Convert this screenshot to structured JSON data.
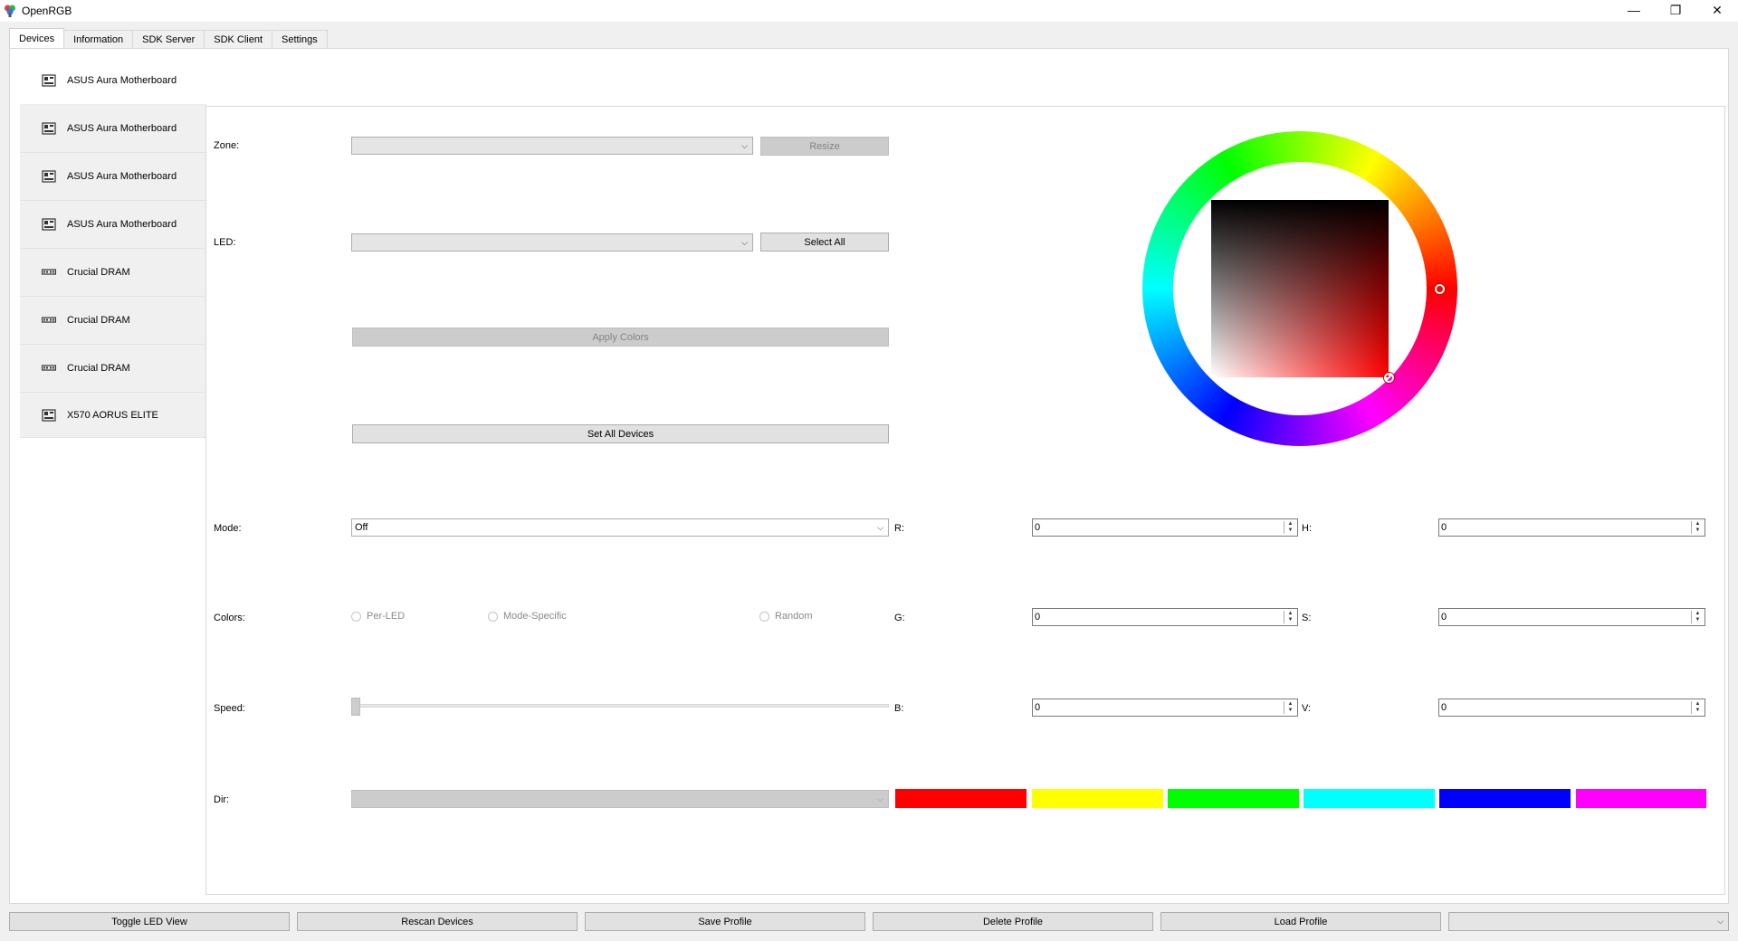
{
  "window": {
    "title": "OpenRGB",
    "minimize_label": "—",
    "restore_label": "❐",
    "close_label": "✕"
  },
  "tabs": [
    {
      "label": "Devices"
    },
    {
      "label": "Information"
    },
    {
      "label": "SDK Server"
    },
    {
      "label": "SDK Client"
    },
    {
      "label": "Settings"
    }
  ],
  "devices": [
    {
      "label": "ASUS Aura Motherboard",
      "icon": "motherboard-icon"
    },
    {
      "label": "ASUS Aura Motherboard",
      "icon": "motherboard-icon"
    },
    {
      "label": "ASUS Aura Motherboard",
      "icon": "motherboard-icon"
    },
    {
      "label": "ASUS Aura Motherboard",
      "icon": "motherboard-icon"
    },
    {
      "label": "Crucial DRAM",
      "icon": "dram-icon"
    },
    {
      "label": "Crucial DRAM",
      "icon": "dram-icon"
    },
    {
      "label": "Crucial DRAM",
      "icon": "dram-icon"
    },
    {
      "label": "X570 AORUS ELITE",
      "icon": "motherboard-icon"
    }
  ],
  "controls": {
    "zone_label": "Zone:",
    "zone_value": "",
    "resize_label": "Resize",
    "led_label": "LED:",
    "led_value": "",
    "select_all_label": "Select All",
    "apply_colors_label": "Apply Colors",
    "set_all_devices_label": "Set All Devices",
    "mode_label": "Mode:",
    "mode_value": "Off",
    "colors_label": "Colors:",
    "radio_per_led": "Per-LED",
    "radio_mode_specific": "Mode-Specific",
    "radio_random": "Random",
    "speed_label": "Speed:",
    "speed_value": 0,
    "dir_label": "Dir:",
    "dir_value": ""
  },
  "rgb": {
    "r_label": "R:",
    "r": "0",
    "g_label": "G:",
    "g": "0",
    "b_label": "B:",
    "b": "0"
  },
  "hsv": {
    "h_label": "H:",
    "h": "0",
    "s_label": "S:",
    "s": "0",
    "v_label": "V:",
    "v": "0"
  },
  "swatches": [
    "#ff0000",
    "#ffff00",
    "#00ff00",
    "#00ffff",
    "#0000ff",
    "#ff00ff"
  ],
  "color_wheel": {
    "hue": 0,
    "saturation": 0,
    "value": 0
  },
  "bottom_buttons": {
    "toggle_led_view": "Toggle LED View",
    "rescan_devices": "Rescan Devices",
    "save_profile": "Save Profile",
    "delete_profile": "Delete Profile",
    "load_profile": "Load Profile",
    "profile_combo_value": ""
  },
  "colors": {
    "tab_bg": "#ffffff",
    "window_bg": "#f0f0f0",
    "button_bg": "#e1e1e1"
  }
}
